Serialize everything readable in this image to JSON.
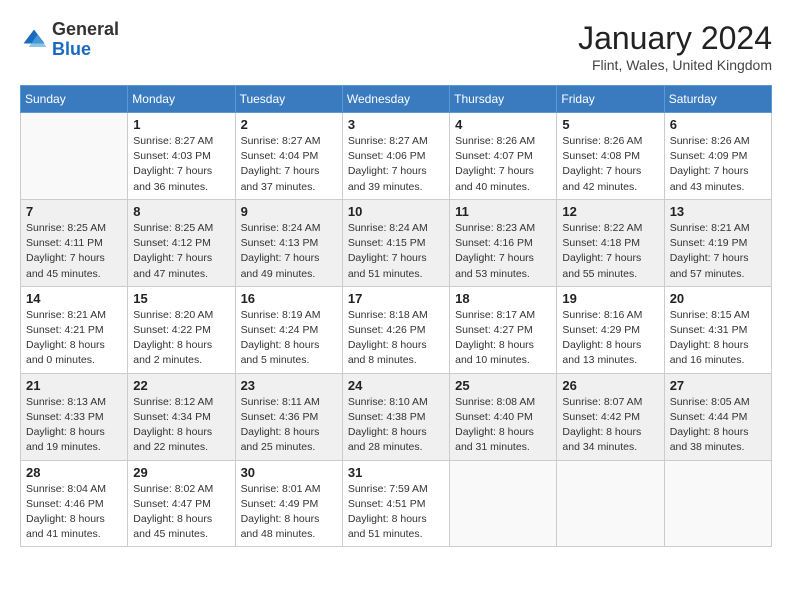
{
  "logo": {
    "general": "General",
    "blue": "Blue"
  },
  "header": {
    "month_year": "January 2024",
    "location": "Flint, Wales, United Kingdom"
  },
  "weekdays": [
    "Sunday",
    "Monday",
    "Tuesday",
    "Wednesday",
    "Thursday",
    "Friday",
    "Saturday"
  ],
  "weeks": [
    [
      {
        "day": "",
        "sunrise": "",
        "sunset": "",
        "daylight": ""
      },
      {
        "day": "1",
        "sunrise": "Sunrise: 8:27 AM",
        "sunset": "Sunset: 4:03 PM",
        "daylight": "Daylight: 7 hours and 36 minutes."
      },
      {
        "day": "2",
        "sunrise": "Sunrise: 8:27 AM",
        "sunset": "Sunset: 4:04 PM",
        "daylight": "Daylight: 7 hours and 37 minutes."
      },
      {
        "day": "3",
        "sunrise": "Sunrise: 8:27 AM",
        "sunset": "Sunset: 4:06 PM",
        "daylight": "Daylight: 7 hours and 39 minutes."
      },
      {
        "day": "4",
        "sunrise": "Sunrise: 8:26 AM",
        "sunset": "Sunset: 4:07 PM",
        "daylight": "Daylight: 7 hours and 40 minutes."
      },
      {
        "day": "5",
        "sunrise": "Sunrise: 8:26 AM",
        "sunset": "Sunset: 4:08 PM",
        "daylight": "Daylight: 7 hours and 42 minutes."
      },
      {
        "day": "6",
        "sunrise": "Sunrise: 8:26 AM",
        "sunset": "Sunset: 4:09 PM",
        "daylight": "Daylight: 7 hours and 43 minutes."
      }
    ],
    [
      {
        "day": "7",
        "sunrise": "Sunrise: 8:25 AM",
        "sunset": "Sunset: 4:11 PM",
        "daylight": "Daylight: 7 hours and 45 minutes."
      },
      {
        "day": "8",
        "sunrise": "Sunrise: 8:25 AM",
        "sunset": "Sunset: 4:12 PM",
        "daylight": "Daylight: 7 hours and 47 minutes."
      },
      {
        "day": "9",
        "sunrise": "Sunrise: 8:24 AM",
        "sunset": "Sunset: 4:13 PM",
        "daylight": "Daylight: 7 hours and 49 minutes."
      },
      {
        "day": "10",
        "sunrise": "Sunrise: 8:24 AM",
        "sunset": "Sunset: 4:15 PM",
        "daylight": "Daylight: 7 hours and 51 minutes."
      },
      {
        "day": "11",
        "sunrise": "Sunrise: 8:23 AM",
        "sunset": "Sunset: 4:16 PM",
        "daylight": "Daylight: 7 hours and 53 minutes."
      },
      {
        "day": "12",
        "sunrise": "Sunrise: 8:22 AM",
        "sunset": "Sunset: 4:18 PM",
        "daylight": "Daylight: 7 hours and 55 minutes."
      },
      {
        "day": "13",
        "sunrise": "Sunrise: 8:21 AM",
        "sunset": "Sunset: 4:19 PM",
        "daylight": "Daylight: 7 hours and 57 minutes."
      }
    ],
    [
      {
        "day": "14",
        "sunrise": "Sunrise: 8:21 AM",
        "sunset": "Sunset: 4:21 PM",
        "daylight": "Daylight: 8 hours and 0 minutes."
      },
      {
        "day": "15",
        "sunrise": "Sunrise: 8:20 AM",
        "sunset": "Sunset: 4:22 PM",
        "daylight": "Daylight: 8 hours and 2 minutes."
      },
      {
        "day": "16",
        "sunrise": "Sunrise: 8:19 AM",
        "sunset": "Sunset: 4:24 PM",
        "daylight": "Daylight: 8 hours and 5 minutes."
      },
      {
        "day": "17",
        "sunrise": "Sunrise: 8:18 AM",
        "sunset": "Sunset: 4:26 PM",
        "daylight": "Daylight: 8 hours and 8 minutes."
      },
      {
        "day": "18",
        "sunrise": "Sunrise: 8:17 AM",
        "sunset": "Sunset: 4:27 PM",
        "daylight": "Daylight: 8 hours and 10 minutes."
      },
      {
        "day": "19",
        "sunrise": "Sunrise: 8:16 AM",
        "sunset": "Sunset: 4:29 PM",
        "daylight": "Daylight: 8 hours and 13 minutes."
      },
      {
        "day": "20",
        "sunrise": "Sunrise: 8:15 AM",
        "sunset": "Sunset: 4:31 PM",
        "daylight": "Daylight: 8 hours and 16 minutes."
      }
    ],
    [
      {
        "day": "21",
        "sunrise": "Sunrise: 8:13 AM",
        "sunset": "Sunset: 4:33 PM",
        "daylight": "Daylight: 8 hours and 19 minutes."
      },
      {
        "day": "22",
        "sunrise": "Sunrise: 8:12 AM",
        "sunset": "Sunset: 4:34 PM",
        "daylight": "Daylight: 8 hours and 22 minutes."
      },
      {
        "day": "23",
        "sunrise": "Sunrise: 8:11 AM",
        "sunset": "Sunset: 4:36 PM",
        "daylight": "Daylight: 8 hours and 25 minutes."
      },
      {
        "day": "24",
        "sunrise": "Sunrise: 8:10 AM",
        "sunset": "Sunset: 4:38 PM",
        "daylight": "Daylight: 8 hours and 28 minutes."
      },
      {
        "day": "25",
        "sunrise": "Sunrise: 8:08 AM",
        "sunset": "Sunset: 4:40 PM",
        "daylight": "Daylight: 8 hours and 31 minutes."
      },
      {
        "day": "26",
        "sunrise": "Sunrise: 8:07 AM",
        "sunset": "Sunset: 4:42 PM",
        "daylight": "Daylight: 8 hours and 34 minutes."
      },
      {
        "day": "27",
        "sunrise": "Sunrise: 8:05 AM",
        "sunset": "Sunset: 4:44 PM",
        "daylight": "Daylight: 8 hours and 38 minutes."
      }
    ],
    [
      {
        "day": "28",
        "sunrise": "Sunrise: 8:04 AM",
        "sunset": "Sunset: 4:46 PM",
        "daylight": "Daylight: 8 hours and 41 minutes."
      },
      {
        "day": "29",
        "sunrise": "Sunrise: 8:02 AM",
        "sunset": "Sunset: 4:47 PM",
        "daylight": "Daylight: 8 hours and 45 minutes."
      },
      {
        "day": "30",
        "sunrise": "Sunrise: 8:01 AM",
        "sunset": "Sunset: 4:49 PM",
        "daylight": "Daylight: 8 hours and 48 minutes."
      },
      {
        "day": "31",
        "sunrise": "Sunrise: 7:59 AM",
        "sunset": "Sunset: 4:51 PM",
        "daylight": "Daylight: 8 hours and 51 minutes."
      },
      {
        "day": "",
        "sunrise": "",
        "sunset": "",
        "daylight": ""
      },
      {
        "day": "",
        "sunrise": "",
        "sunset": "",
        "daylight": ""
      },
      {
        "day": "",
        "sunrise": "",
        "sunset": "",
        "daylight": ""
      }
    ]
  ]
}
